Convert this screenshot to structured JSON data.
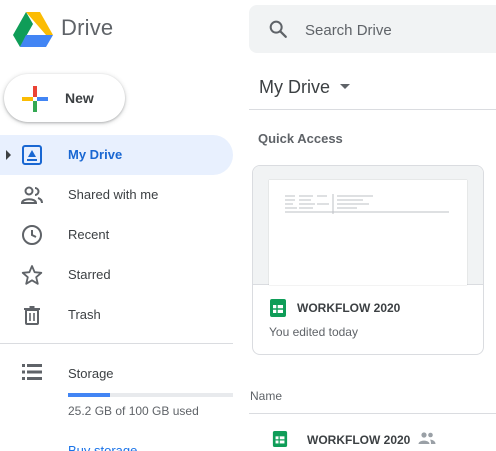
{
  "brand": {
    "name": "Drive"
  },
  "search": {
    "placeholder": "Search Drive"
  },
  "new_button": {
    "label": "New"
  },
  "sidebar": {
    "items": [
      {
        "label": "My Drive",
        "icon": "my-drive-icon",
        "active": true
      },
      {
        "label": "Shared with me",
        "icon": "shared-with-me-icon",
        "active": false
      },
      {
        "label": "Recent",
        "icon": "clock-icon",
        "active": false
      },
      {
        "label": "Starred",
        "icon": "star-icon",
        "active": false
      },
      {
        "label": "Trash",
        "icon": "trash-icon",
        "active": false
      }
    ]
  },
  "storage": {
    "label": "Storage",
    "used_text": "25.2 GB of 100 GB used",
    "used_fraction": 0.252,
    "buy_label": "Buy storage"
  },
  "main": {
    "title": "My Drive",
    "quick_access": {
      "label": "Quick Access",
      "card": {
        "name": "WORKFLOW 2020",
        "meta": "You edited today",
        "icon": "sheets-icon"
      }
    },
    "list": {
      "column_name": "Name",
      "files": [
        {
          "name": "WORKFLOW 2020",
          "icon": "sheets-icon",
          "shared": true
        }
      ]
    }
  },
  "colors": {
    "accent": "#1967d2",
    "active_bg": "#e8f0fe",
    "sheets_green": "#0f9d58",
    "storage_fill": "#4285f4",
    "search_bg": "#f1f3f4"
  }
}
